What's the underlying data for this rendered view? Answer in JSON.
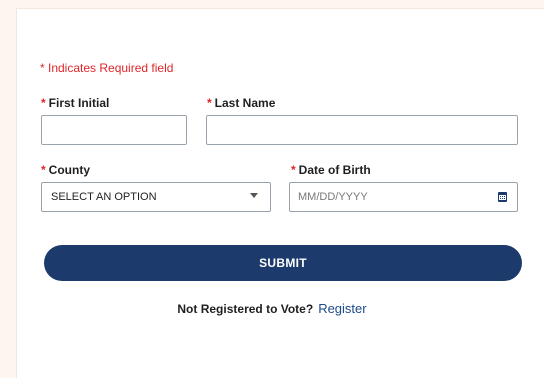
{
  "form": {
    "required_note": "* Indicates Required field",
    "required_star": "*",
    "first_initial": {
      "label": "First Initial",
      "value": ""
    },
    "last_name": {
      "label": "Last Name",
      "value": ""
    },
    "county": {
      "label": "County",
      "selected": "SELECT AN OPTION"
    },
    "dob": {
      "label": "Date of Birth",
      "placeholder": "MM/DD/YYYY"
    },
    "submit_label": "SUBMIT",
    "register_question": "Not Registered to Vote?",
    "register_link": "Register"
  },
  "icons": {
    "select_caret": "chevron-down-icon",
    "date_picker": "calendar-icon"
  },
  "colors": {
    "required": "#e0262b",
    "primary": "#1d3a6c",
    "link": "#1d4a8a",
    "page_bg": "#fdf6ee"
  }
}
